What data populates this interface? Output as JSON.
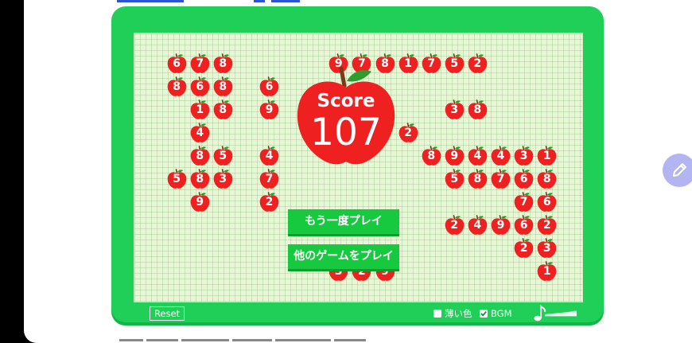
{
  "game": {
    "score_label": "Score",
    "score_value": "107",
    "buttons": {
      "play_again": "もう一度プレイ",
      "other_games": "他のゲームをプレイ"
    },
    "controls": {
      "reset": "Reset",
      "light_color_label": "薄い色",
      "light_color_checked": false,
      "bgm_label": "BGM",
      "bgm_checked": true
    },
    "apples": [
      {
        "row": 0,
        "col": 1,
        "value": "6"
      },
      {
        "row": 0,
        "col": 2,
        "value": "7"
      },
      {
        "row": 0,
        "col": 3,
        "value": "8"
      },
      {
        "row": 0,
        "col": 8,
        "value": "9"
      },
      {
        "row": 0,
        "col": 9,
        "value": "7"
      },
      {
        "row": 0,
        "col": 10,
        "value": "8"
      },
      {
        "row": 0,
        "col": 11,
        "value": "1"
      },
      {
        "row": 0,
        "col": 12,
        "value": "7"
      },
      {
        "row": 0,
        "col": 13,
        "value": "5"
      },
      {
        "row": 0,
        "col": 14,
        "value": "2"
      },
      {
        "row": 1,
        "col": 1,
        "value": "8"
      },
      {
        "row": 1,
        "col": 2,
        "value": "6"
      },
      {
        "row": 1,
        "col": 3,
        "value": "8"
      },
      {
        "row": 1,
        "col": 5,
        "value": "6"
      },
      {
        "row": 2,
        "col": 2,
        "value": "1"
      },
      {
        "row": 2,
        "col": 3,
        "value": "8"
      },
      {
        "row": 2,
        "col": 5,
        "value": "9"
      },
      {
        "row": 2,
        "col": 13,
        "value": "3"
      },
      {
        "row": 2,
        "col": 14,
        "value": "8"
      },
      {
        "row": 3,
        "col": 2,
        "value": "4"
      },
      {
        "row": 3,
        "col": 11,
        "value": "2"
      },
      {
        "row": 4,
        "col": 2,
        "value": "8"
      },
      {
        "row": 4,
        "col": 3,
        "value": "5"
      },
      {
        "row": 4,
        "col": 5,
        "value": "4"
      },
      {
        "row": 4,
        "col": 12,
        "value": "8"
      },
      {
        "row": 4,
        "col": 13,
        "value": "9"
      },
      {
        "row": 4,
        "col": 14,
        "value": "4"
      },
      {
        "row": 4,
        "col": 15,
        "value": "4"
      },
      {
        "row": 4,
        "col": 16,
        "value": "3"
      },
      {
        "row": 4,
        "col": 17,
        "value": "1"
      },
      {
        "row": 5,
        "col": 1,
        "value": "5"
      },
      {
        "row": 5,
        "col": 2,
        "value": "8"
      },
      {
        "row": 5,
        "col": 3,
        "value": "3"
      },
      {
        "row": 5,
        "col": 5,
        "value": "7"
      },
      {
        "row": 5,
        "col": 13,
        "value": "5"
      },
      {
        "row": 5,
        "col": 14,
        "value": "8"
      },
      {
        "row": 5,
        "col": 15,
        "value": "7"
      },
      {
        "row": 5,
        "col": 16,
        "value": "6"
      },
      {
        "row": 5,
        "col": 17,
        "value": "8"
      },
      {
        "row": 6,
        "col": 2,
        "value": "9"
      },
      {
        "row": 6,
        "col": 5,
        "value": "2"
      },
      {
        "row": 6,
        "col": 16,
        "value": "7"
      },
      {
        "row": 6,
        "col": 17,
        "value": "6"
      },
      {
        "row": 7,
        "col": 13,
        "value": "2"
      },
      {
        "row": 7,
        "col": 14,
        "value": "4"
      },
      {
        "row": 7,
        "col": 15,
        "value": "9"
      },
      {
        "row": 7,
        "col": 16,
        "value": "6"
      },
      {
        "row": 7,
        "col": 17,
        "value": "2"
      },
      {
        "row": 8,
        "col": 16,
        "value": "2"
      },
      {
        "row": 8,
        "col": 17,
        "value": "3"
      },
      {
        "row": 9,
        "col": 8,
        "value": "3"
      },
      {
        "row": 9,
        "col": 9,
        "value": "2"
      },
      {
        "row": 9,
        "col": 10,
        "value": "9"
      },
      {
        "row": 9,
        "col": 17,
        "value": "1"
      }
    ]
  },
  "colors": {
    "frame": "#1fcf58",
    "board": "#e7f6d4",
    "apple": "#ee2020",
    "button": "#17c93f"
  },
  "icons": {
    "music": "music-note-icon",
    "edit": "pencil-icon",
    "checkbox": "checkmark-icon"
  }
}
